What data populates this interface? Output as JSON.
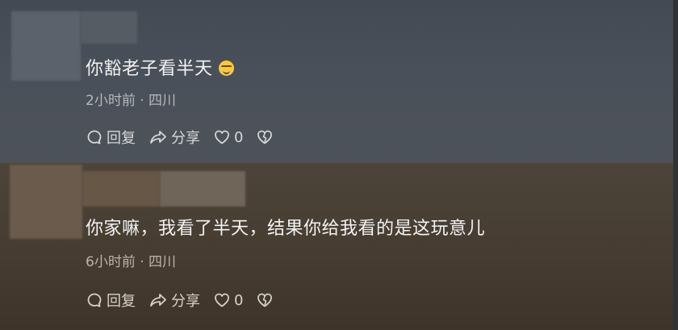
{
  "comments": [
    {
      "text": "你豁老子看半天",
      "emoji": "grinning-face-emoji",
      "time": "2小时前 · 四川",
      "reply_label": "回复",
      "share_label": "分享",
      "like_count": "0"
    },
    {
      "text": "你家嘛，我看了半天，结果你给我看的是这玩意儿",
      "time": "6小时前 · 四川",
      "reply_label": "回复",
      "share_label": "分享",
      "like_count": "0"
    }
  ],
  "colors": {
    "text": "#f3f3f3",
    "meta": "#b5b8bc",
    "emoji": "#f6c945"
  }
}
